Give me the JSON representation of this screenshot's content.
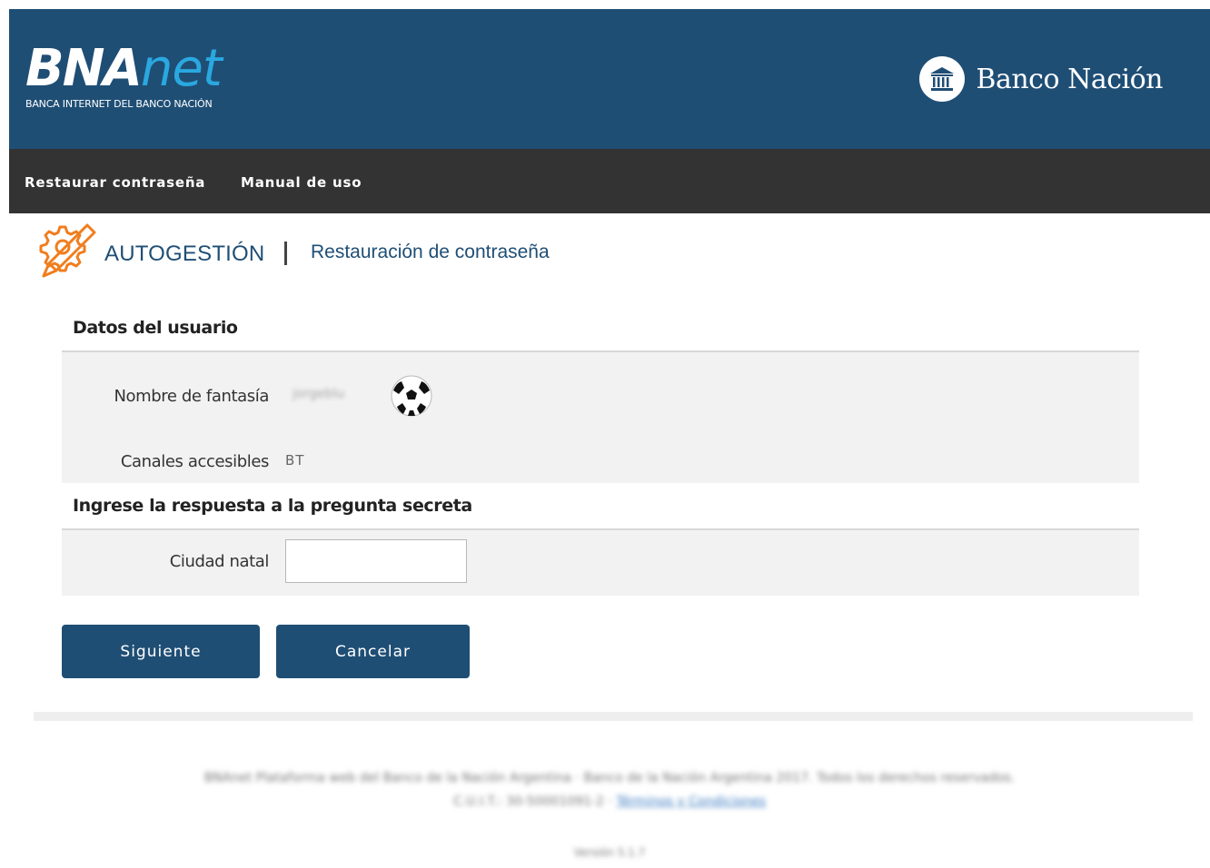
{
  "header": {
    "logo_main": "BNA",
    "logo_net": "net",
    "logo_subtitle": "BANCA INTERNET DEL BANCO NACIÓN",
    "bank_name": "Banco Nación",
    "background_color": "#1f4e75",
    "accent_color": "#2aa8e0"
  },
  "nav": {
    "items": [
      {
        "label": "Restaurar contraseña"
      },
      {
        "label": "Manual de uso"
      }
    ]
  },
  "breadcrumb": {
    "icon": "gear-pencil-icon",
    "title": "AUTOGESTIÓN",
    "subtitle": "Restauración de contraseña"
  },
  "user_section": {
    "title": "Datos del usuario",
    "fantasy_name_label": "Nombre de fantasía",
    "fantasy_name_value": "jorgeblu",
    "avatar_icon": "soccer-ball-icon",
    "channels_label": "Canales accesibles",
    "channels_value": "BT"
  },
  "question_section": {
    "title": "Ingrese la respuesta a la pregunta secreta",
    "question_label": "Ciudad natal",
    "answer_value": "",
    "answer_placeholder": ""
  },
  "actions": {
    "next_label": "Siguiente",
    "cancel_label": "Cancelar"
  },
  "footer": {
    "line1": "BNAnet Plataforma web del Banco de la Nación Argentina · Banco de la Nación Argentina 2017. Todos los derechos reservados.",
    "line2_text": "C.U.I.T.: 30-50001091-2 ·",
    "line2_link": "Términos y Condiciones",
    "version": "Versión 5.1.7"
  }
}
